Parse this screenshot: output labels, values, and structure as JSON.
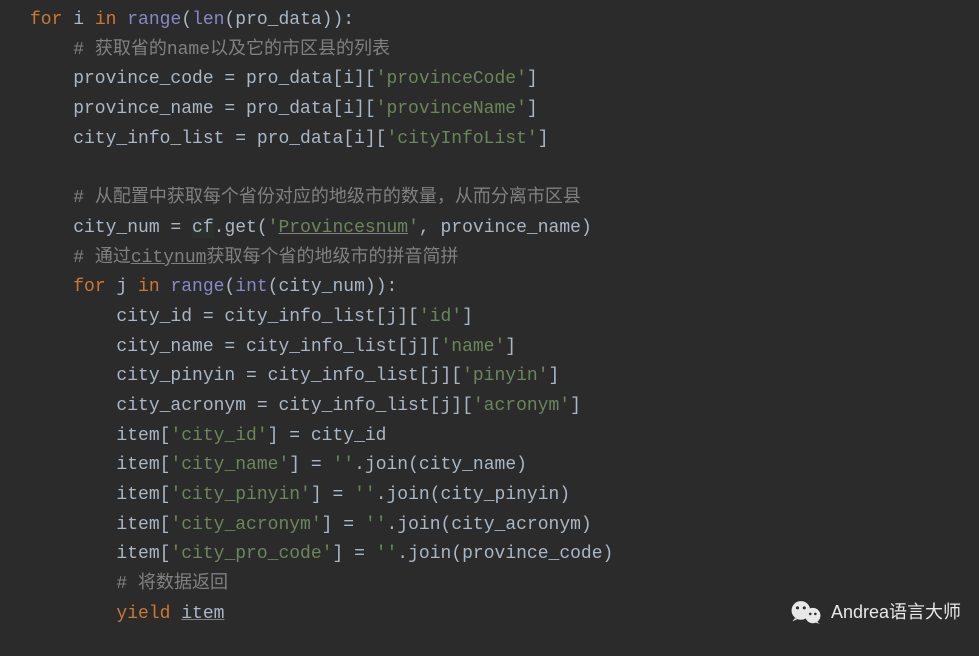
{
  "code": {
    "l1": {
      "a": "for",
      "b": " i ",
      "c": "in",
      "d": " ",
      "e": "range",
      "f": "(",
      "g": "len",
      "h": "(pro_data)):"
    },
    "l2": {
      "a": "    ",
      "b": "# 获取省的name以及它的市区县的列表"
    },
    "l3": {
      "a": "    province_code = pro_data[i][",
      "b": "'provinceCode'",
      "c": "]"
    },
    "l4": {
      "a": "    province_name = pro_data[i][",
      "b": "'provinceName'",
      "c": "]"
    },
    "l5": {
      "a": "    city_info_list = pro_data[i][",
      "b": "'cityInfoList'",
      "c": "]"
    },
    "blank1": " ",
    "l6": {
      "a": "    ",
      "b": "# 从配置中获取每个省份对应的地级市的数量，从而分离市区县"
    },
    "l7": {
      "a": "    city_num = ",
      "b": "cf",
      "c": ".get(",
      "d": "'",
      "e": "Provincesnum",
      "f": "'",
      "g": ", ",
      "h": "province_name)"
    },
    "l8": {
      "a": "    ",
      "b": "# 通过",
      "c": "citynum",
      "d": "获取每个省的地级市的拼音简拼"
    },
    "l9": {
      "a": "    ",
      "b": "for",
      "c": " j ",
      "d": "in",
      "e": " ",
      "f": "range",
      "g": "(",
      "h": "int",
      "i": "(city_num)):"
    },
    "l10": {
      "a": "        city_id = city_info_list[j][",
      "b": "'id'",
      "c": "]"
    },
    "l11": {
      "a": "        city_name = city_info_list[j][",
      "b": "'name'",
      "c": "]"
    },
    "l12": {
      "a": "        city_pinyin = city_info_list[j][",
      "b": "'pinyin'",
      "c": "]"
    },
    "l13": {
      "a": "        city_acronym = city_info_list[j][",
      "b": "'acronym'",
      "c": "]"
    },
    "l14": {
      "a": "        item[",
      "b": "'city_id'",
      "c": "] = city_id"
    },
    "l15": {
      "a": "        item[",
      "b": "'city_name'",
      "c": "] = ",
      "d": "''",
      "e": ".join(city_name)"
    },
    "l16": {
      "a": "        item[",
      "b": "'city_pinyin'",
      "c": "] = ",
      "d": "''",
      "e": ".join(city_pinyin)"
    },
    "l17": {
      "a": "        item[",
      "b": "'city_acronym'",
      "c": "] = ",
      "d": "''",
      "e": ".join(city_acronym)"
    },
    "l18": {
      "a": "        item[",
      "b": "'city_pro_code'",
      "c": "] = ",
      "d": "''",
      "e": ".join(province_code)"
    },
    "l19": {
      "a": "        ",
      "b": "# 将数据返回"
    },
    "l20": {
      "a": "        ",
      "b": "yield",
      "c": " ",
      "d": "item"
    }
  },
  "watermark": {
    "text": "Andrea语言大师"
  }
}
